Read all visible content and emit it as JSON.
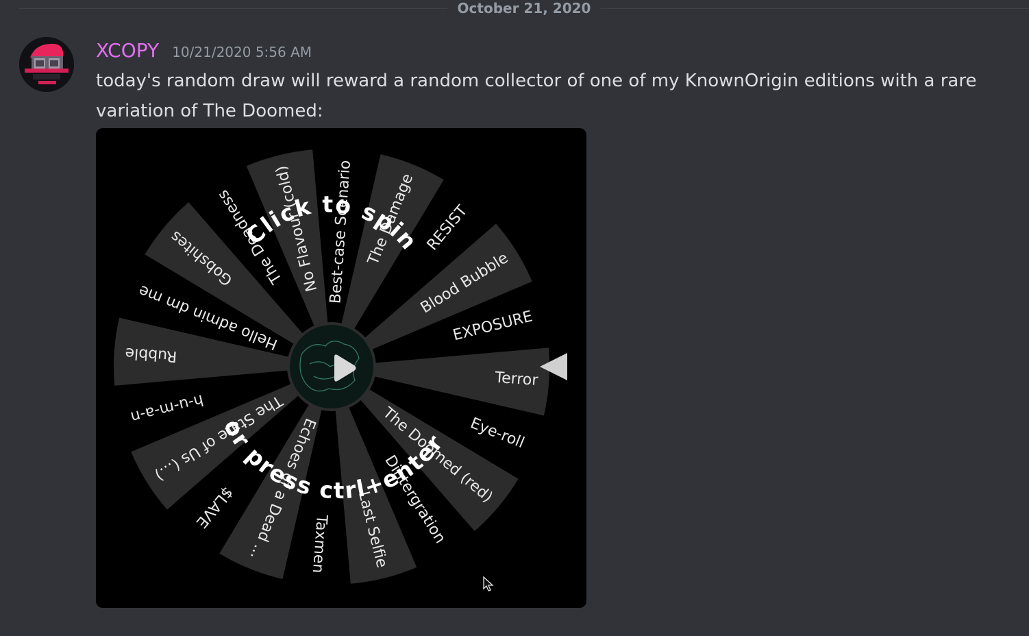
{
  "date_divider": {
    "label": "October 21, 2020"
  },
  "message": {
    "author": "XCOPY",
    "author_color": "#e66ef2",
    "timestamp": "10/21/2020 5:56 AM",
    "text": "today's random draw will reward a random collector of one of my KnownOrigin editions with a rare variation of The Doomed:",
    "avatar_icon": "avatar-image"
  },
  "embed": {
    "type": "spinning-wheel-animation",
    "prompt_top": "Click to spin",
    "prompt_bottom": "or press ctrl+enter",
    "center_icon": "play-icon",
    "pointer_icon": "wheel-pointer-icon",
    "cursor_icon": "mouse-cursor-icon",
    "segments": [
      "Terror",
      "Eye-roll",
      "The Doomed (red)",
      "Dintergration",
      "Last Selfie",
      "Taxmen",
      "Echoes of a Dead ...",
      "$LAVE",
      "The State of Us (...)",
      "h-u-m-a-n",
      "Rubble",
      "Hello admin dm me",
      "Gobshites",
      "The Deadness",
      "No Flavour (cold)",
      "Best-case Scenario",
      "The Damage",
      "RESIST",
      "Blood Bubble",
      "EXPOSURE"
    ],
    "segment_colors": [
      "#2c2c2c",
      "#000000"
    ]
  }
}
